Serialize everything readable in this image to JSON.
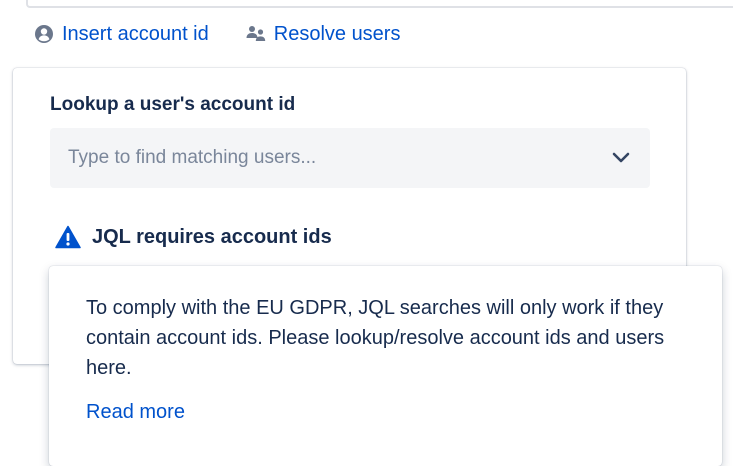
{
  "actions": {
    "insert_account_id": {
      "label": "Insert account id",
      "icon": "user-circle-icon"
    },
    "resolve_users": {
      "label": "Resolve users",
      "icon": "people-group-icon"
    }
  },
  "lookup": {
    "label": "Lookup a user's account id",
    "placeholder": "Type to find matching users..."
  },
  "warning": {
    "icon": "warning-triangle-icon",
    "title": "JQL requires account ids"
  },
  "tooltip": {
    "body": "To comply with the EU GDPR, JQL searches will only work if they contain account ids. Please lookup/resolve account ids and users here.",
    "link": "Read more"
  },
  "colors": {
    "link": "#0052cc",
    "text": "#172b4d",
    "placeholder": "#7a869a",
    "field_bg": "#f4f5f7",
    "icon_gray": "#6b778c",
    "warning_bg": "#0052cc"
  }
}
